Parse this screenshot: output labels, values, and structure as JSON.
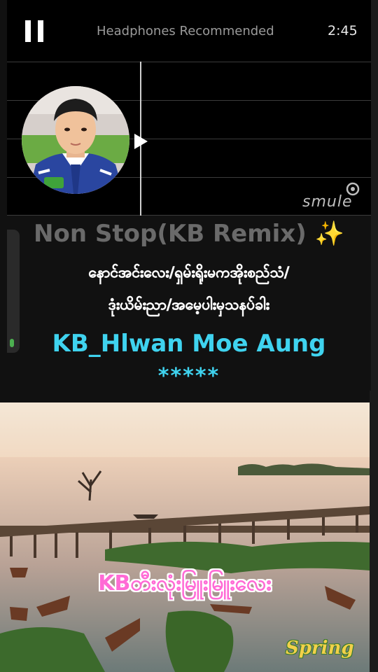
{
  "header": {
    "pause_icon": "pause-icon",
    "hint": "Headphones Recommended",
    "elapsed": "2:45"
  },
  "player": {
    "brand": "smule",
    "play_marker_icon": "play-marker-icon"
  },
  "lyrics": {
    "title": "Non Stop(KB Remix)",
    "title_emoji": "✨",
    "line2": "နောင်အင်းလေး/ရှမ်းရိုးမကအိုးစည်သံ/",
    "line3": "ဒုံးယိမ်းညာ/အမေ့ပါးမှသနပ်ခါး",
    "name": "KB_Hlwan Moe Aung",
    "stars": "*****",
    "accent": "#3fd3ef",
    "volume_level": 0.07
  },
  "photo": {
    "caption": "KBတီးလုံးမြူးမြူးလေး",
    "stamp": "Spring",
    "caption_color": "#ff6ad5"
  }
}
